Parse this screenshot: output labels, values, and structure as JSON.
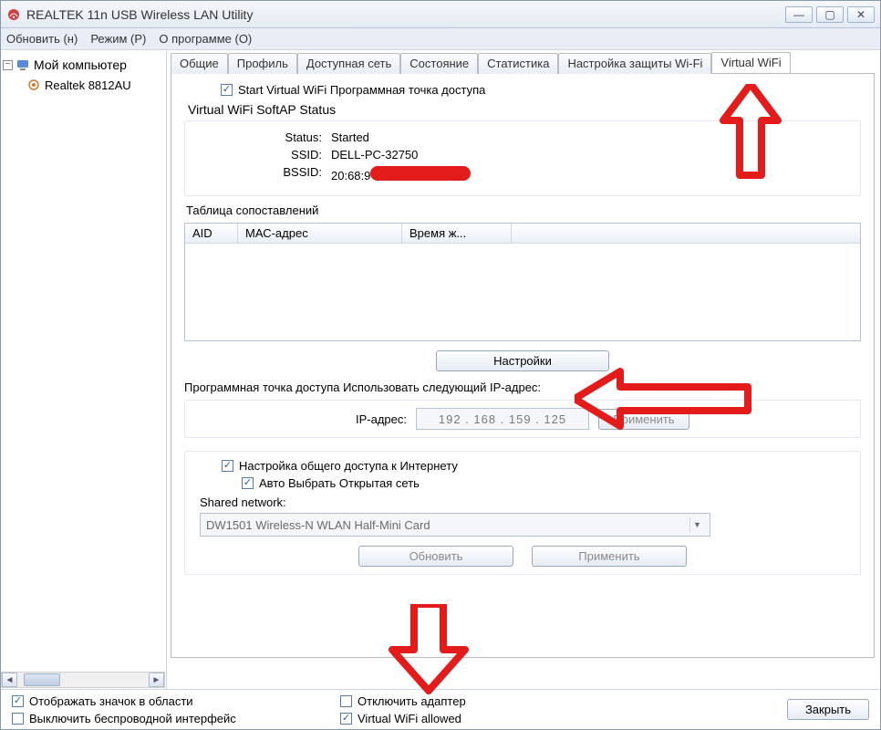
{
  "window": {
    "title": "REALTEK 11n USB Wireless LAN Utility"
  },
  "menu": {
    "refresh": "Обновить (н)",
    "mode": "Режим (Р)",
    "about": "О программе (О)"
  },
  "tree": {
    "root": "Мой компьютер",
    "adapter": "Realtek 8812AU"
  },
  "tabs": {
    "general": "Общие",
    "profile": "Профиль",
    "available": "Доступная сеть",
    "status": "Состояние",
    "statistics": "Статистика",
    "wifi_protection": "Настройка защиты Wi-Fi",
    "virtual_wifi": "Virtual WiFi"
  },
  "vwifi": {
    "start_label": "Start Virtual WiFi Программная точка доступа",
    "softap_status_title": "Virtual WiFi SoftAP Status",
    "status_k": "Status:",
    "status_v": "Started",
    "ssid_k": "SSID:",
    "ssid_v": "DELL-PC-32750",
    "bssid_k": "BSSID:",
    "bssid_v_prefix": "20:68:9",
    "assoc_table": "Таблица сопоставлений",
    "col_aid": "AID",
    "col_mac": "МАС-адрес",
    "col_time": "Время ж...",
    "settings_btn": "Настройки",
    "ip_line": "Программная точка доступа Использовать следующий IP-адрес:",
    "ip_label": "IP-адрес:",
    "ip_value": "192 . 168 . 159 . 125",
    "apply_btn": "Применить",
    "ics_label": "Настройка общего доступа к Интернету",
    "auto_open_label": "Авто Выбрать Открытая сеть",
    "shared_net_label": "Shared network:",
    "shared_net_value": "DW1501 Wireless-N WLAN Half-Mini Card",
    "refresh_btn": "Обновить",
    "apply2_btn": "Применить"
  },
  "bottom": {
    "tray_icon": "Отображать значок в области",
    "radio_off": "Выключить беспроводной интерфейс",
    "disable_adapter": "Отключить адаптер",
    "vwifi_allowed": "Virtual WiFi allowed",
    "close": "Закрыть"
  }
}
